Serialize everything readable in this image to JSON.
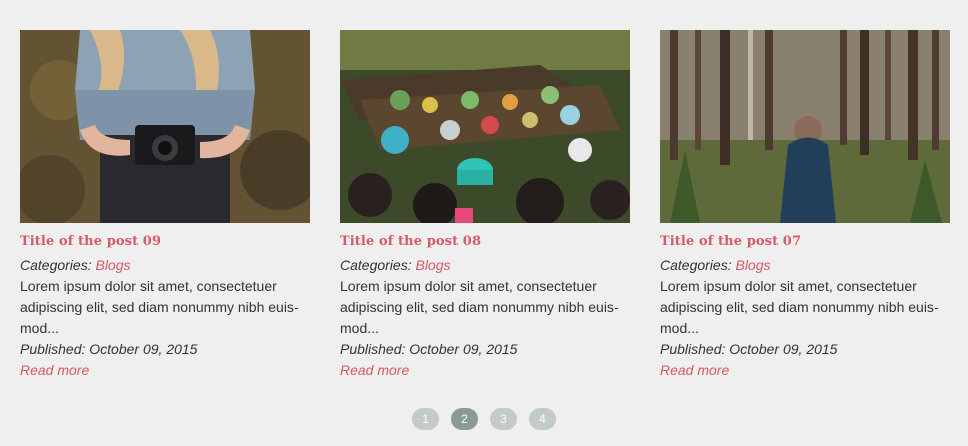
{
  "posts": [
    {
      "title": "Title of the post 09",
      "categories_label": "Categories:",
      "category": "Blogs",
      "excerpt": "Lorem ipsum dolor sit amet, consectetuer adipiscing elit, sed diam nonummy nibh euis-mod...",
      "published_label": "Published:",
      "published_date": "October 09, 2015",
      "read_more": "Read more",
      "image": "photo-woman-with-camera"
    },
    {
      "title": "Title of the post 08",
      "categories_label": "Categories:",
      "category": "Blogs",
      "excerpt": "Lorem ipsum dolor sit amet, consectetuer adipiscing elit, sed diam nonummy nibh euis-mod...",
      "published_label": "Published:",
      "published_date": "October 09, 2015",
      "read_more": "Read more",
      "image": "photo-floating-market"
    },
    {
      "title": "Title of the post 07",
      "categories_label": "Categories:",
      "category": "Blogs",
      "excerpt": "Lorem ipsum dolor sit amet, consectetuer adipiscing elit, sed diam nonummy nibh euis-mod...",
      "published_label": "Published:",
      "published_date": "October 09, 2015",
      "read_more": "Read more",
      "image": "photo-person-in-forest"
    }
  ],
  "pagination": {
    "pages": [
      "1",
      "2",
      "3",
      "4"
    ],
    "current": "2"
  },
  "colors": {
    "accent": "#d85868",
    "background": "#efeff0",
    "pager_inactive": "#c3cbc8",
    "pager_active": "#8b9a95"
  }
}
